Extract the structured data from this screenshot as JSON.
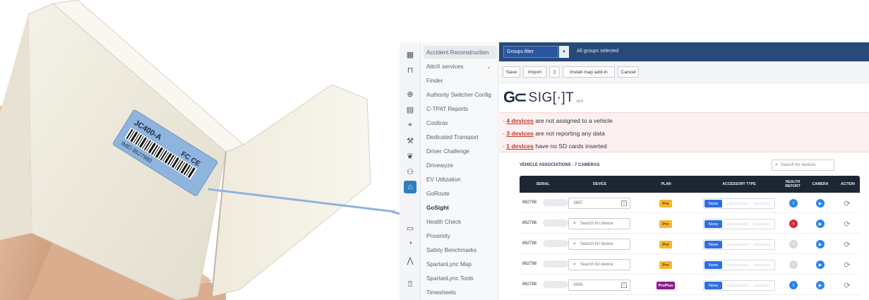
{
  "photo": {
    "label_model": "JC400-A",
    "label_imei": "IMEI 8627980",
    "label_marks": "FC CE"
  },
  "sidebar": {
    "icons": [
      "grid-icon",
      "bookmark-icon",
      "globe-icon",
      "report-icon",
      "pin-icon",
      "wrench-icon",
      "leaf-icon",
      "users-icon",
      "addin-icon",
      "camera-icon",
      "bell-icon",
      "map-icon",
      "help-icon"
    ],
    "items": [
      {
        "label": "Accident Reconstruction"
      },
      {
        "label": "AttriX services"
      },
      {
        "label": "Finder"
      },
      {
        "label": "Authority Switcher Config"
      },
      {
        "label": "C-TPAT Reports"
      },
      {
        "label": "Cooltrax"
      },
      {
        "label": "Dedicated Transport"
      },
      {
        "label": "Driver Challenge"
      },
      {
        "label": "Drivewyze"
      },
      {
        "label": "EV Utilization"
      },
      {
        "label": "GoRoute"
      },
      {
        "label": "GoSight"
      },
      {
        "label": "Health Check"
      },
      {
        "label": "Proximity"
      },
      {
        "label": "Safety Benchmarks"
      },
      {
        "label": "SpartanLync Map"
      },
      {
        "label": "SpartanLync Tools"
      },
      {
        "label": "Timesheets"
      }
    ]
  },
  "topbar": {
    "groups_filter": "Groups filter",
    "groups_selected": "All groups selected"
  },
  "toolbar": {
    "save": "Save",
    "import": "Import",
    "install": "Install map add-in",
    "cancel": "Cancel"
  },
  "logo": {
    "word": "SIG",
    "word2": "T",
    "version": "v3.0"
  },
  "alerts": [
    {
      "link": "4 devices",
      "text": " are not assigned to a vehicle"
    },
    {
      "link": "3 devices",
      "text": " are not reporting any data"
    },
    {
      "link": "1 devices",
      "text": " have no SD cards inserted"
    }
  ],
  "table": {
    "title": "VEHICLE ASSOCIATIONS - 7 CAMERAS",
    "search_placeholder": "Search for devices",
    "headers": {
      "serial": "SERIAL",
      "device": "DEVICE",
      "plan": "PLAN",
      "accessory": "ACCESSORY TYPE",
      "health": "HEALTH REPORT",
      "camera": "CAMERA",
      "action": "ACTION"
    },
    "none_label": "None",
    "rows": [
      {
        "serial": "862798",
        "device": "3897",
        "plan": "Pro",
        "health": "blue"
      },
      {
        "serial": "862798",
        "device": "Search for device",
        "plan": "Pro",
        "health": "red"
      },
      {
        "serial": "862798",
        "device": "Search for device",
        "plan": "Pro",
        "health": "gray"
      },
      {
        "serial": "862798",
        "device": "Search for device",
        "plan": "Pro",
        "health": "gray"
      },
      {
        "serial": "862798",
        "device": "3906",
        "plan": "ProPlus",
        "health": "blue"
      }
    ]
  },
  "colors": {
    "topbar": "#274a7a",
    "accent_blue": "#2c85e8",
    "alert_bg": "#fdf0f0",
    "alert_link": "#c0392b",
    "plan_pro": "#f5b731",
    "plan_proplus": "#8a1b8c",
    "arrow": "#8fb3dc"
  }
}
